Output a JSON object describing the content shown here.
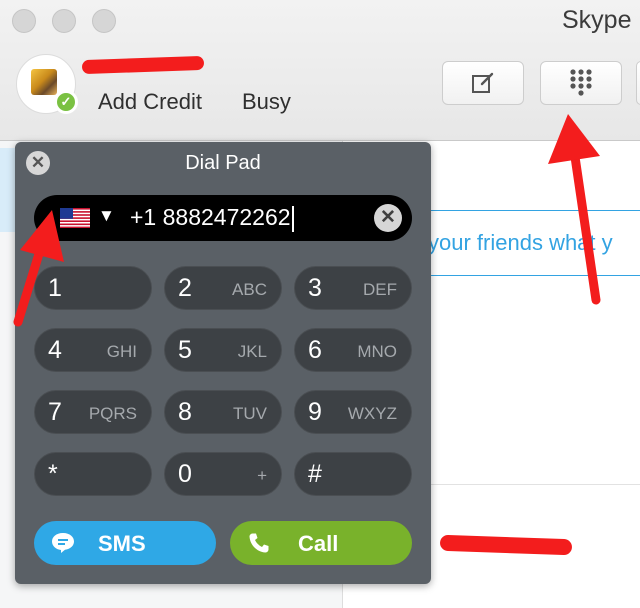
{
  "window": {
    "title": "Skype"
  },
  "profile": {
    "add_credit": "Add Credit",
    "presence": "Busy",
    "avatar_icon": "avatar-icon",
    "status_icon": "check-icon"
  },
  "toolbar": {
    "compose_icon": "compose-icon",
    "dialpad_icon": "dialpad-icon"
  },
  "background": {
    "status_placeholder": "your friends what y"
  },
  "dialpad": {
    "title": "Dial Pad",
    "close_glyph": "✕",
    "clear_glyph": "✕",
    "country_flag": "us-flag-icon",
    "country_caret": "▼",
    "number": "+1 8882472262",
    "keys": [
      {
        "digit": "1",
        "letters": ""
      },
      {
        "digit": "2",
        "letters": "ABC"
      },
      {
        "digit": "3",
        "letters": "DEF"
      },
      {
        "digit": "4",
        "letters": "GHI"
      },
      {
        "digit": "5",
        "letters": "JKL"
      },
      {
        "digit": "6",
        "letters": "MNO"
      },
      {
        "digit": "7",
        "letters": "PQRS"
      },
      {
        "digit": "8",
        "letters": "TUV"
      },
      {
        "digit": "9",
        "letters": "WXYZ"
      },
      {
        "digit": "*",
        "letters": ""
      },
      {
        "digit": "0",
        "letters": "+"
      },
      {
        "digit": "#",
        "letters": ""
      }
    ],
    "sms_label": "SMS",
    "call_label": "Call"
  },
  "colors": {
    "accent_blue": "#2fa8e6",
    "call_green": "#79b22b",
    "annotation_red": "#f31d1d"
  }
}
